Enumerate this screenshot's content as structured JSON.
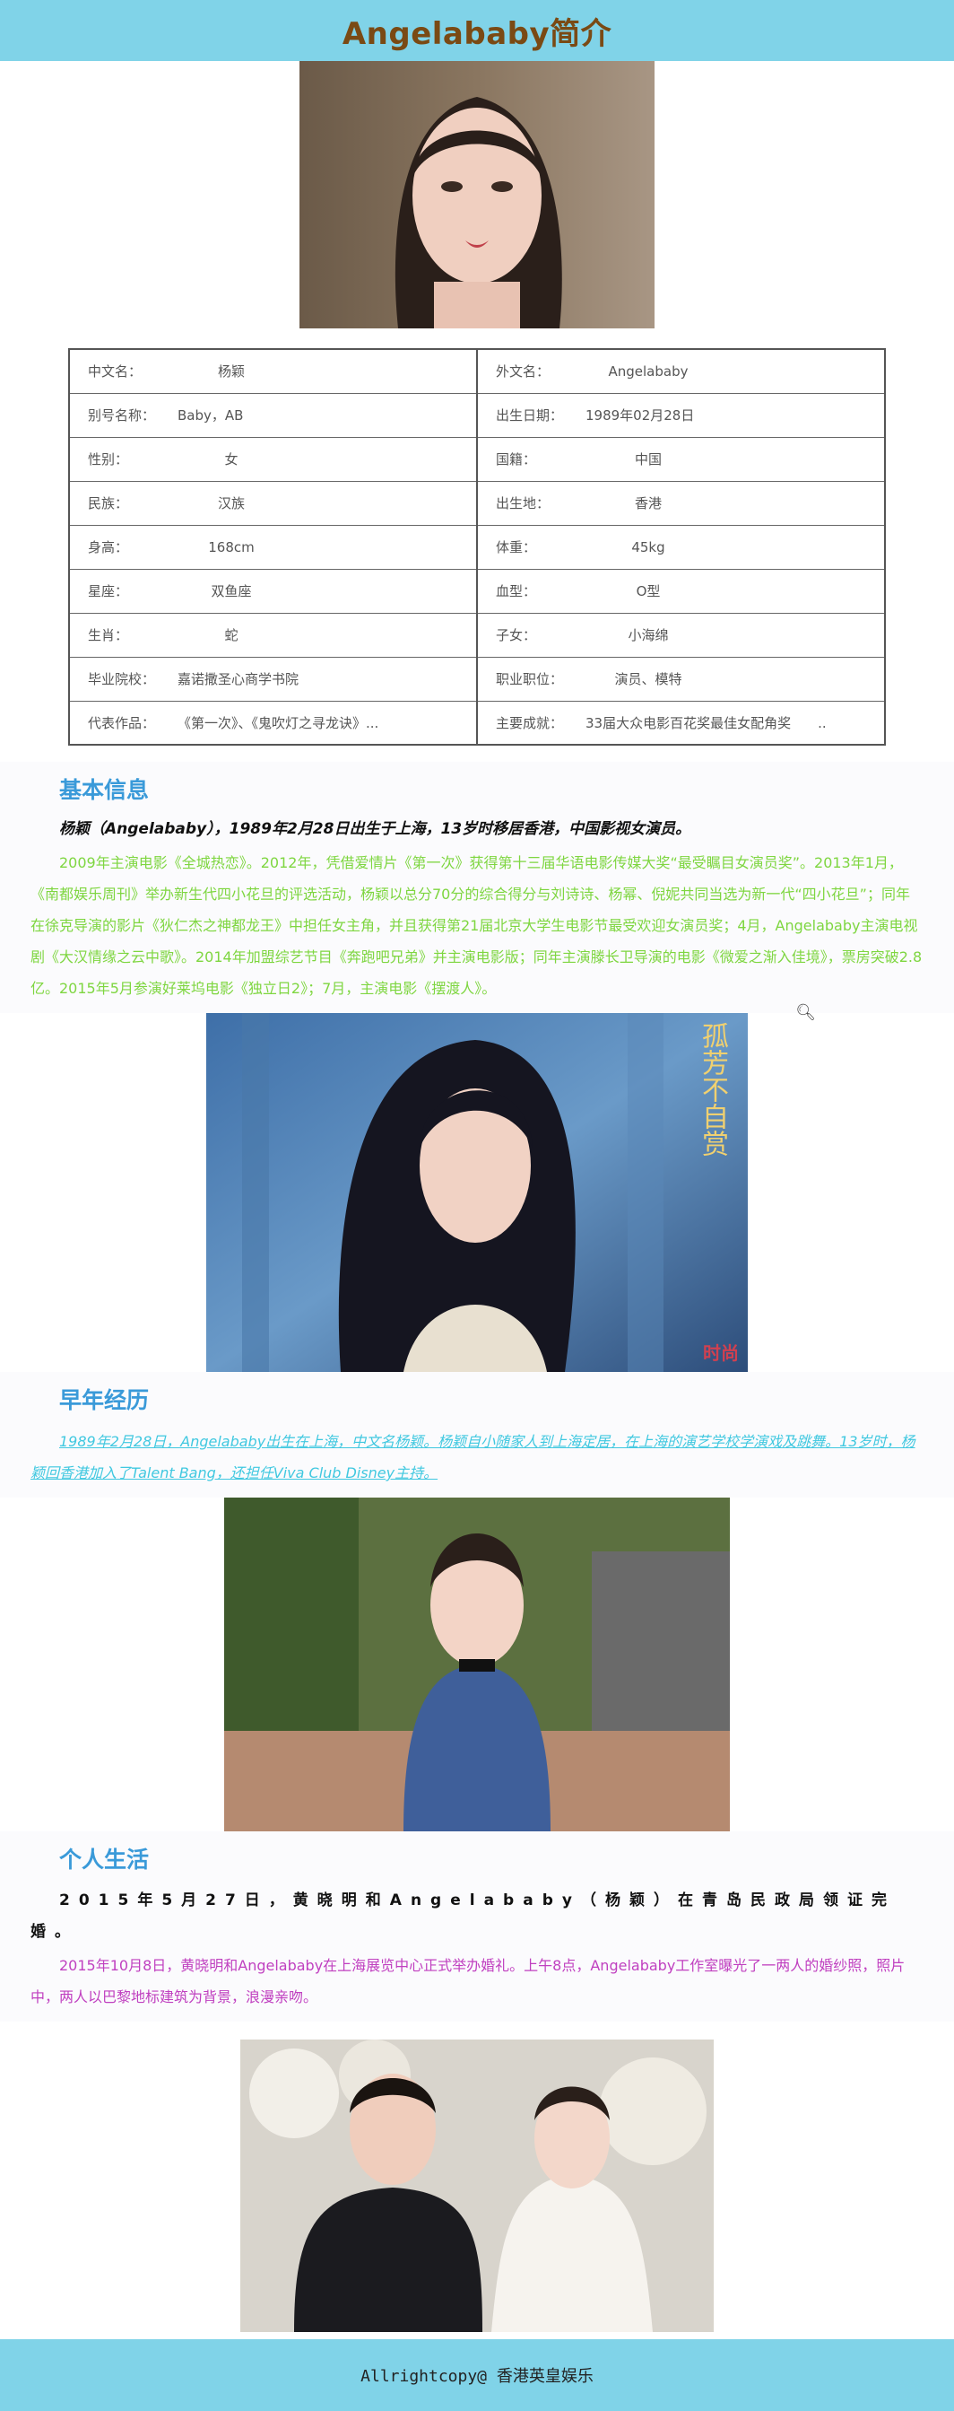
{
  "header": {
    "title": "Angelababy简介"
  },
  "table": {
    "rows": [
      [
        {
          "label": "中文名：",
          "value": "杨颖"
        },
        {
          "label": "外文名：",
          "value": "Angelababy"
        }
      ],
      [
        {
          "label": "别号名称：",
          "value": "Baby，AB"
        },
        {
          "label": "出生日期：",
          "value": "1989年02月28日"
        }
      ],
      [
        {
          "label": "性别：",
          "value": "女"
        },
        {
          "label": "国籍：",
          "value": "中国"
        }
      ],
      [
        {
          "label": "民族：",
          "value": "汉族"
        },
        {
          "label": "出生地：",
          "value": "香港"
        }
      ],
      [
        {
          "label": "身高：",
          "value": "168cm"
        },
        {
          "label": "体重：",
          "value": "45kg"
        }
      ],
      [
        {
          "label": "星座：",
          "value": "双鱼座"
        },
        {
          "label": "血型：",
          "value": "O型"
        }
      ],
      [
        {
          "label": "生肖：",
          "value": "蛇"
        },
        {
          "label": "子女：",
          "value": "小海绵"
        }
      ],
      [
        {
          "label": "毕业院校：",
          "value": "嘉诺撒圣心商学书院"
        },
        {
          "label": "职业职位：",
          "value": "演员、模特"
        }
      ],
      [
        {
          "label": "代表作品：",
          "value": "《第一次》、《鬼吹灯之寻龙诀》..."
        },
        {
          "label": "主要成就：",
          "value": "33届大众电影百花奖最佳女配角奖　　.."
        }
      ]
    ]
  },
  "basic": {
    "title": "基本信息",
    "lead": "杨颖（Angelababy），1989年2月28日出生于上海，13岁时移居香港，中国影视女演员。",
    "para": "2009年主演电影《全城热恋》。2012年，凭借爱情片《第一次》获得第十三届华语电影传媒大奖“最受瞩目女演员奖”。2013年1月，《南都娱乐周刊》举办新生代四小花旦的评选活动，杨颖以总分70分的综合得分与刘诗诗、杨幂、倪妮共同当选为新一代“四小花旦”；同年在徐克导演的影片《狄仁杰之神都龙王》中担任女主角，并且获得第21届北京大学生电影节最受欢迎女演员奖；4月，Angelababy主演电视剧《大汉情缘之云中歌》。2014年加盟综艺节目《奔跑吧兄弟》并主演电影版；同年主演滕长卫导演的电影《微爱之渐入佳境》，票房突破2.8亿。2015年5月参演好莱坞电影《独立日2》；7月，主演电影《摆渡人》。",
    "zoom_icon": "zoom-in-icon"
  },
  "early": {
    "title": "早年经历",
    "para": "1989年2月28日，Angelababy出生在上海，中文名杨颖。杨颖自小随家人到上海定居，在上海的演艺学校学演戏及跳舞。13岁时，杨颖回香港加入了Talent Bang，还担任Viva Club Disney主持。"
  },
  "life": {
    "title": "个人生活",
    "lead": "2015年5月27日，黄晓明和Angelababy（杨颖）在青岛民政局领证完婚。",
    "para": "2015年10月8日，黄晓明和Angelababy在上海展览中心正式举办婚礼。上午8点，Angelababy工作室曝光了一两人的婚纱照，照片中，两人以巴黎地标建筑为背景，浪漫亲吻。"
  },
  "photos": {
    "photo2_caption": "孤芳不自赏",
    "photo2_watermark": "时尚"
  },
  "footer": {
    "text": "Allrightcopy@ 香港英皇娱乐"
  },
  "colors": {
    "header_bg": "#80d3e8",
    "title": "#7a4a14",
    "section_title": "#3a9ad9",
    "green": "#7ed640",
    "cyan": "#40c8e0",
    "purple": "#c040c0"
  }
}
